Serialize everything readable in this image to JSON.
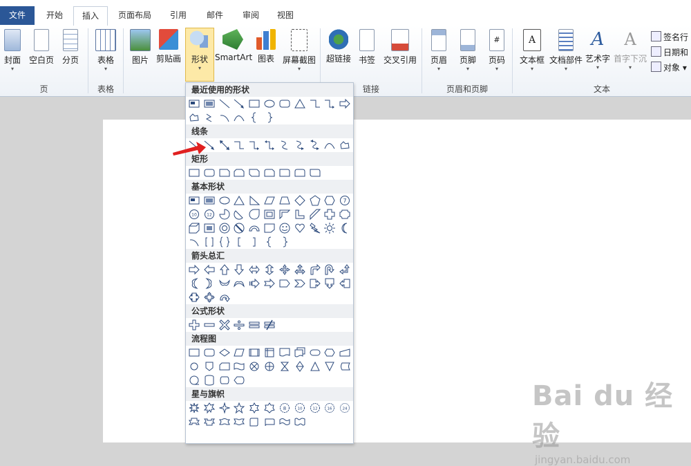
{
  "tabs": [
    "文件",
    "开始",
    "插入",
    "页面布局",
    "引用",
    "邮件",
    "审阅",
    "视图"
  ],
  "ribbon": {
    "buttons": {
      "cover": "封面",
      "blank": "空白页",
      "pagebreak": "分页",
      "table": "表格",
      "picture": "图片",
      "clipart": "剪贴画",
      "shapes": "形状",
      "smartart": "SmartArt",
      "chart": "图表",
      "screenshot": "屏幕截图",
      "hyperlink": "超链接",
      "bookmark": "书签",
      "crossref": "交叉引用",
      "header": "页眉",
      "footer": "页脚",
      "pagenum": "页码",
      "textbox": "文本框",
      "quickparts": "文档部件",
      "wordart": "艺术字",
      "dropcap": "首字下沉"
    },
    "small": {
      "signature": "签名行",
      "datetime": "日期和",
      "object": "对象"
    },
    "groups": {
      "pages": "页",
      "tables": "表格",
      "links": "链接",
      "headerfooter": "页眉和页脚",
      "text": "文本"
    }
  },
  "dropdown": {
    "sections": {
      "recent": "最近使用的形状",
      "lines": "线条",
      "rect": "矩形",
      "basic": "基本形状",
      "arrows": "箭头总汇",
      "equation": "公式形状",
      "flowchart": "流程图",
      "stars": "星与旗帜"
    }
  },
  "watermark": {
    "main": "Bai du 经验",
    "sub": "jingyan.baidu.com"
  },
  "colors": {
    "file_tab": "#2b5797",
    "highlight": "#fde9a7",
    "annotation_arrow": "#e02020"
  }
}
